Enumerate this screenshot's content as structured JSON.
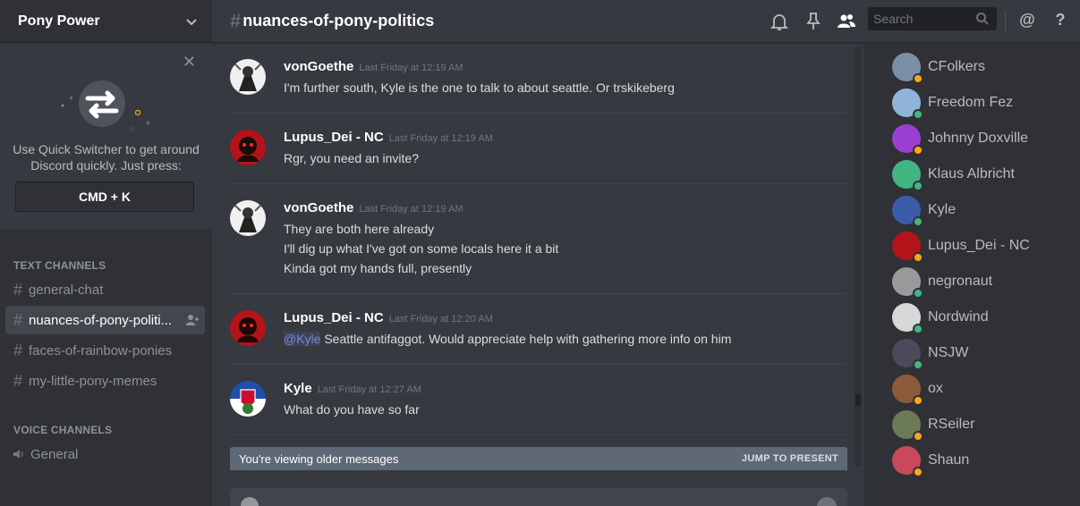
{
  "server": {
    "name": "Pony Power"
  },
  "quick_switcher": {
    "text": "Use Quick Switcher to get around Discord quickly. Just press:",
    "shortcut": "CMD + K"
  },
  "categories": {
    "text": "TEXT CHANNELS",
    "voice": "VOICE CHANNELS"
  },
  "channels": [
    {
      "name": "general-chat",
      "active": false
    },
    {
      "name": "nuances-of-pony-politi...",
      "active": true
    },
    {
      "name": "faces-of-rainbow-ponies",
      "active": false
    },
    {
      "name": "my-little-pony-memes",
      "active": false
    }
  ],
  "voice_channels": [
    {
      "name": "General"
    }
  ],
  "topbar": {
    "channel": "nuances-of-pony-politics",
    "search_placeholder": "Search",
    "mentions_icon": "@",
    "help_icon": "?"
  },
  "messages": [
    {
      "author": "vonGoethe",
      "timestamp": "Last Friday at 12:19 AM",
      "lines": [
        "I'm further south, Kyle is the one to talk to about seattle. Or trskikeberg"
      ]
    },
    {
      "author": "Lupus_Dei - NC",
      "timestamp": "Last Friday at 12:19 AM",
      "lines": [
        "Rgr, you need an invite?"
      ]
    },
    {
      "author": "vonGoethe",
      "timestamp": "Last Friday at 12:19 AM",
      "lines": [
        "They are both here already",
        "I'll dig up what I've got on some locals here it a bit",
        "Kinda got my hands full, presently"
      ]
    },
    {
      "author": "Lupus_Dei - NC",
      "timestamp": "Last Friday at 12:20 AM",
      "mention": "@Kyle",
      "lines": [
        " Seattle antifaggot. Would appreciate help with gathering more info on him"
      ]
    },
    {
      "author": "Kyle",
      "timestamp": "Last Friday at 12:27 AM",
      "lines": [
        "What do you have so far"
      ]
    }
  ],
  "older_bar": {
    "text": "You're viewing older messages",
    "jump": "JUMP TO PRESENT"
  },
  "members": [
    {
      "name": "CFolkers",
      "status": "idle",
      "color": "#7a8fa6"
    },
    {
      "name": "Freedom Fez",
      "status": "online",
      "color": "#8fb3d9"
    },
    {
      "name": "Johnny Doxville",
      "status": "idle",
      "color": "#9b3fd1"
    },
    {
      "name": "Klaus Albricht",
      "status": "online",
      "color": "#43b581"
    },
    {
      "name": "Kyle",
      "status": "online",
      "color": "#3b5ca8"
    },
    {
      "name": "Lupus_Dei - NC",
      "status": "idle",
      "color": "#b3141a"
    },
    {
      "name": "negronaut",
      "status": "online",
      "color": "#9a9a9a"
    },
    {
      "name": "Nordwind",
      "status": "online",
      "color": "#d8d8d8"
    },
    {
      "name": "NSJW",
      "status": "online",
      "color": "#4a4a5a"
    },
    {
      "name": "ox",
      "status": "idle",
      "color": "#8a5a3a"
    },
    {
      "name": "RSeiler",
      "status": "idle",
      "color": "#6d7a5a"
    },
    {
      "name": "Shaun",
      "status": "idle",
      "color": "#c9485a"
    }
  ],
  "status_colors": {
    "online": "#43b581",
    "idle": "#faa61a"
  }
}
